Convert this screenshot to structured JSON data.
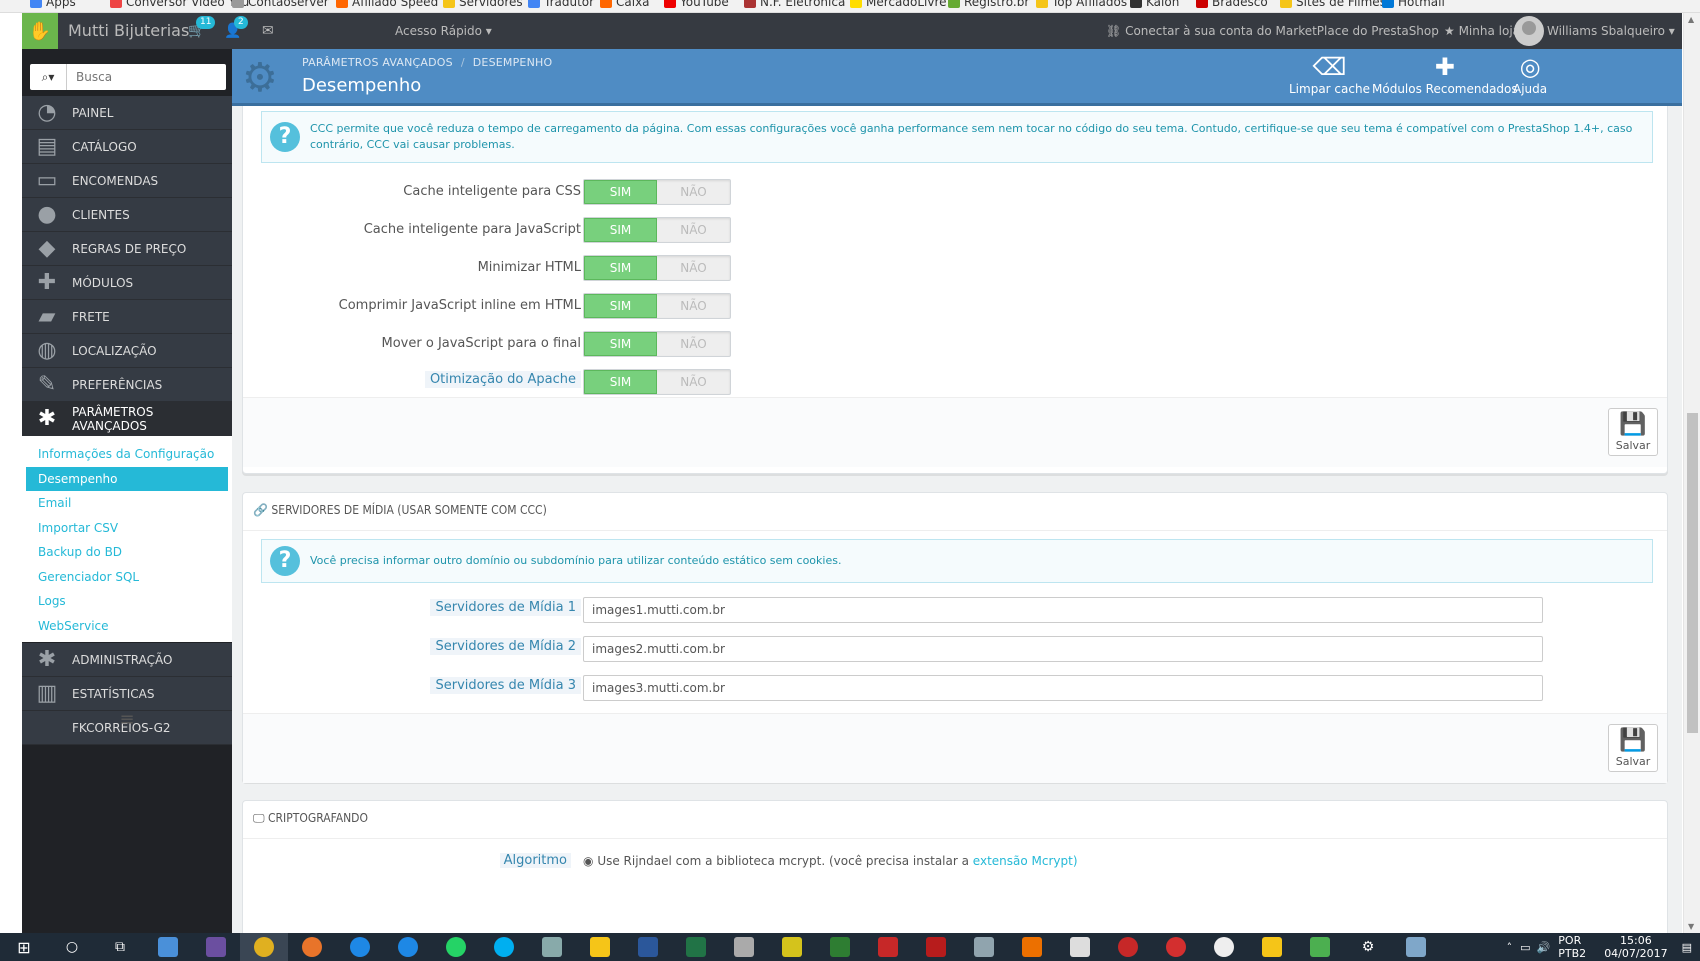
{
  "bookmarks": [
    {
      "label": "Apps",
      "color": "#4285f4"
    },
    {
      "label": "Conversor Video You",
      "color": "#e44"
    },
    {
      "label": "Contaoserver",
      "color": "#999"
    },
    {
      "label": "Afiliado Speed",
      "color": "#f60"
    },
    {
      "label": "Servidores",
      "color": "#f5c518"
    },
    {
      "label": "Tradutor",
      "color": "#4285f4"
    },
    {
      "label": "Caixa",
      "color": "#f60"
    },
    {
      "label": "YouTube",
      "color": "#e00"
    },
    {
      "label": "N.F. Eletrônica",
      "color": "#a33"
    },
    {
      "label": "MercadoLivre",
      "color": "#fd0"
    },
    {
      "label": "Registro.br",
      "color": "#6a3"
    },
    {
      "label": "Top Afiliados",
      "color": "#f5c518"
    },
    {
      "label": "Kaloh",
      "color": "#333"
    },
    {
      "label": "Bradesco",
      "color": "#c00"
    },
    {
      "label": "Sites de Filmes",
      "color": "#f5c518"
    },
    {
      "label": "Hotmail",
      "color": "#0078d7"
    }
  ],
  "header": {
    "shop_name": "Mutti Bijuterias",
    "cart_badge": "11",
    "users_badge": "2",
    "quick_access": "Acesso Rápido",
    "connect": "Conectar à sua conta do MarketPlace do PrestaShop",
    "my_shop": "Minha loja",
    "user_name": "Williams Sbalqueiro"
  },
  "sidebar": {
    "search_placeholder": "Busca",
    "items": [
      {
        "label": "PAINEL",
        "icon": "dashboard-icon",
        "glyph": "◔"
      },
      {
        "label": "CATÁLOGO",
        "icon": "catalog-icon",
        "glyph": "▤"
      },
      {
        "label": "ENCOMENDAS",
        "icon": "orders-icon",
        "glyph": "▭"
      },
      {
        "label": "CLIENTES",
        "icon": "customers-icon",
        "glyph": "●"
      },
      {
        "label": "REGRAS DE PREÇO",
        "icon": "price-rules-icon",
        "glyph": "◆"
      },
      {
        "label": "MÓDULOS",
        "icon": "modules-icon",
        "glyph": "✚"
      },
      {
        "label": "FRETE",
        "icon": "shipping-icon",
        "glyph": "▰"
      },
      {
        "label": "LOCALIZAÇÃO",
        "icon": "localization-icon",
        "glyph": "◍"
      },
      {
        "label": "PREFERÊNCIAS",
        "icon": "preferences-icon",
        "glyph": "✎"
      },
      {
        "label": "PARÂMETROS AVANÇADOS",
        "icon": "advanced-parameters-icon",
        "glyph": "✱"
      }
    ],
    "subitems": [
      {
        "label": "Informações da Configuração"
      },
      {
        "label": "Desempenho"
      },
      {
        "label": "Email"
      },
      {
        "label": "Importar CSV"
      },
      {
        "label": "Backup do BD"
      },
      {
        "label": "Gerenciador SQL"
      },
      {
        "label": "Logs"
      },
      {
        "label": "WebService"
      }
    ],
    "items2": [
      {
        "label": "ADMINISTRAÇÃO",
        "icon": "administration-icon",
        "glyph": "✱"
      },
      {
        "label": "ESTATÍSTICAS",
        "icon": "stats-icon",
        "glyph": "▥"
      },
      {
        "label": "FKCORREIOS-G2",
        "icon": "",
        "glyph": ""
      }
    ]
  },
  "pagehead": {
    "breadcrumb_1": "PARÂMETROS AVANÇADOS",
    "breadcrumb_2": "DESEMPENHO",
    "title": "Desempenho",
    "clear_cache": "Limpar cache",
    "recommended_modules": "Módulos Recomendados",
    "help": "Ajuda"
  },
  "ccc_panel": {
    "info": "CCC permite que você reduza o tempo de carregamento da página. Com essas configurações você ganha performance sem nem tocar no código do seu tema. Contudo, certifique-se que seu tema é compatível com o PrestaShop 1.4+, caso contrário, CCC vai causar problemas.",
    "yes": "SIM",
    "no": "NÃO",
    "options": [
      {
        "label": "Cache inteligente para CSS",
        "value": "SIM",
        "hint": false
      },
      {
        "label": "Cache inteligente para JavaScript",
        "value": "SIM",
        "hint": false
      },
      {
        "label": "Minimizar HTML",
        "value": "SIM",
        "hint": false
      },
      {
        "label": "Comprimir JavaScript inline em HTML",
        "value": "SIM",
        "hint": false
      },
      {
        "label": "Mover o JavaScript para o final",
        "value": "SIM",
        "hint": false
      },
      {
        "label": "Otimização do Apache",
        "value": "SIM",
        "hint": true
      }
    ],
    "save": "Salvar"
  },
  "media_panel": {
    "title": "SERVIDORES DE MÍDIA (USAR SOMENTE COM CCC)",
    "info": "Você precisa informar outro domínio ou subdomínio para utilizar conteúdo estático sem cookies.",
    "servers": [
      {
        "label": "Servidores de Mídia 1",
        "value": "images1.mutti.com.br"
      },
      {
        "label": "Servidores de Mídia 2",
        "value": "images2.mutti.com.br"
      },
      {
        "label": "Servidores de Mídia 3",
        "value": "images3.mutti.com.br"
      }
    ],
    "save": "Salvar"
  },
  "crypto_panel": {
    "title": "CRIPTOGRAFANDO",
    "algorithm_label": "Algoritmo",
    "option_text": "Use Rijndael com a biblioteca mcrypt. (você precisa instalar a",
    "option_link": "extensão Mcrypt)"
  },
  "taskbar": {
    "language": "POR",
    "language2": "PTB2",
    "time": "15:06",
    "date": "04/07/2017"
  }
}
